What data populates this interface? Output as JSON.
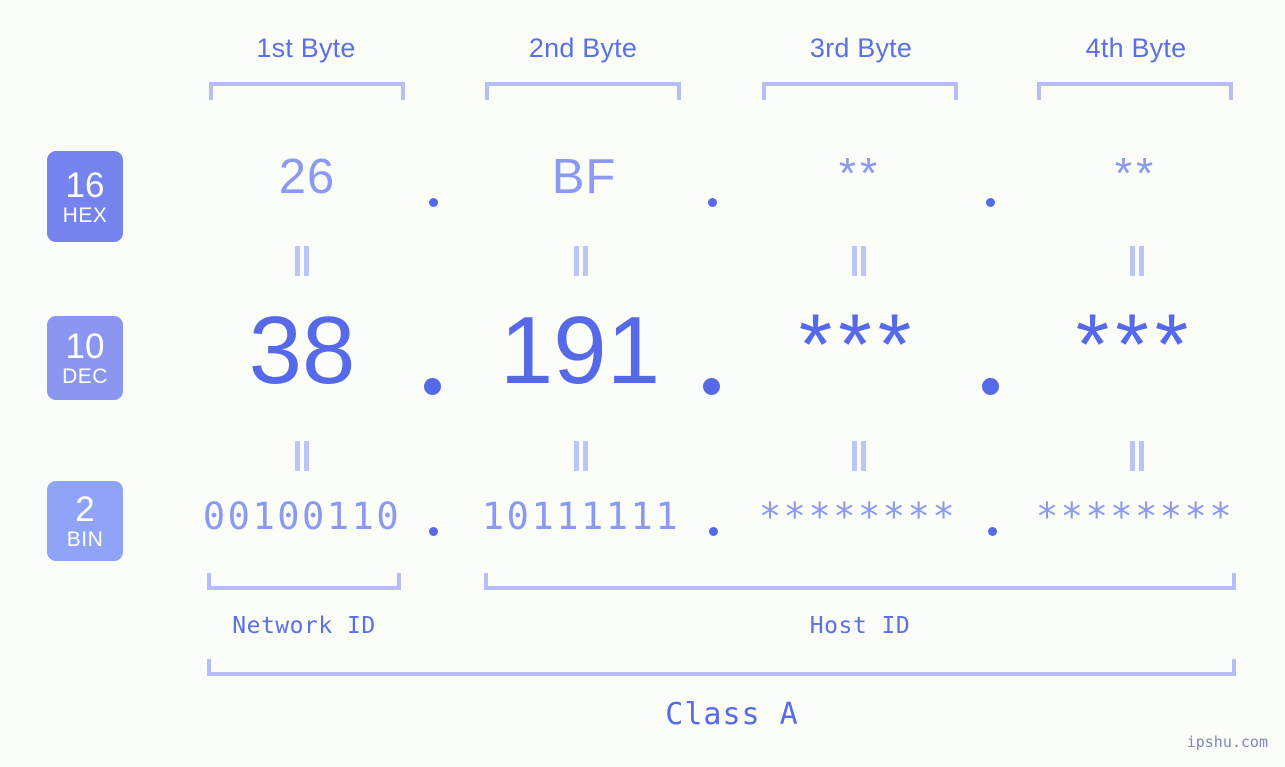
{
  "background_color": "#fbfdf9",
  "accent_colors": {
    "strong": "#5669e8",
    "mid": "#8b99f2",
    "light": "#b6bdf7",
    "badge_hex": "#7583ee",
    "badge_dec": "#8a96f0",
    "badge_bin": "#8fa4f7"
  },
  "byte_headers": [
    {
      "label": "1st Byte"
    },
    {
      "label": "2nd Byte"
    },
    {
      "label": "3rd Byte"
    },
    {
      "label": "4th Byte"
    }
  ],
  "bases": [
    {
      "number": "16",
      "name": "HEX"
    },
    {
      "number": "10",
      "name": "DEC"
    },
    {
      "number": "2",
      "name": "BIN"
    }
  ],
  "rows": {
    "hex": {
      "values": [
        "26",
        "BF",
        "**",
        "**"
      ]
    },
    "dec": {
      "values": [
        "38",
        "191",
        "***",
        "***"
      ]
    },
    "bin": {
      "values": [
        "00100110",
        "10111111",
        "********",
        "********"
      ]
    }
  },
  "separator": ".",
  "equals_symbol": "=",
  "segments": {
    "network": "Network ID",
    "host": "Host ID"
  },
  "class_label": "Class A",
  "watermark": "ipshu.com"
}
